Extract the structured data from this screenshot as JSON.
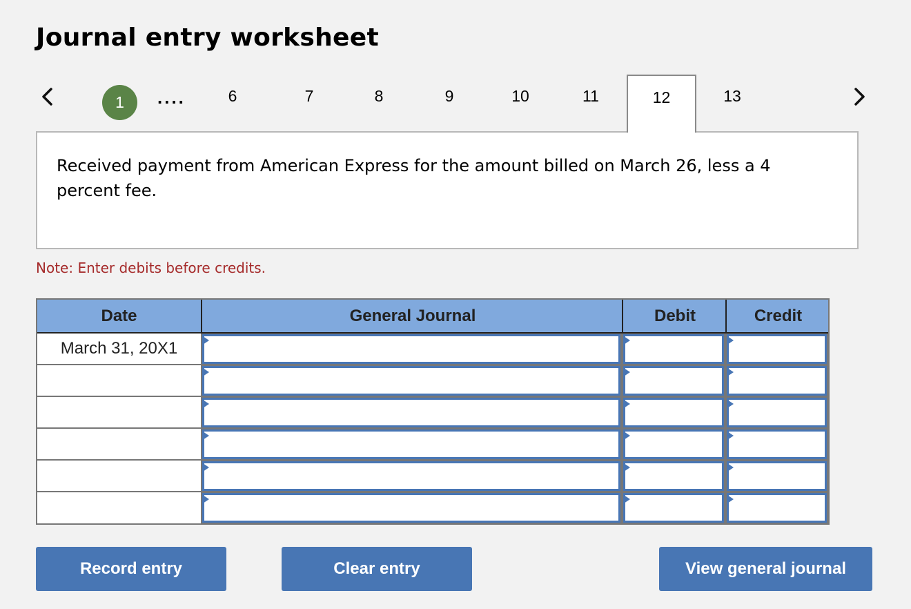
{
  "header": {
    "title": "Journal entry worksheet"
  },
  "pager": {
    "prev_icon": "chevron-left-icon",
    "next_icon": "chevron-right-icon",
    "current_step": "1",
    "current_step_color": "#5a8447",
    "ellipsis": "....",
    "steps": [
      "6",
      "7",
      "8",
      "9",
      "10",
      "11",
      "12",
      "13"
    ],
    "active_step": "12"
  },
  "question": {
    "text": "Received payment from American Express for the amount billed on March 26, less a 4 percent fee."
  },
  "note": {
    "text": "Note: Enter debits before credits.",
    "color": "#a52a2a"
  },
  "table": {
    "header_color": "#80a9dd",
    "columns": [
      "Date",
      "General Journal",
      "Debit",
      "Credit"
    ],
    "rows": [
      {
        "date": "March 31, 20X1",
        "account": "",
        "debit": "",
        "credit": ""
      },
      {
        "date": "",
        "account": "",
        "debit": "",
        "credit": ""
      },
      {
        "date": "",
        "account": "",
        "debit": "",
        "credit": ""
      },
      {
        "date": "",
        "account": "",
        "debit": "",
        "credit": ""
      },
      {
        "date": "",
        "account": "",
        "debit": "",
        "credit": ""
      },
      {
        "date": "",
        "account": "",
        "debit": "",
        "credit": ""
      }
    ]
  },
  "buttons": {
    "record": "Record entry",
    "clear": "Clear entry",
    "view": "View general journal",
    "color": "#4876b4"
  }
}
